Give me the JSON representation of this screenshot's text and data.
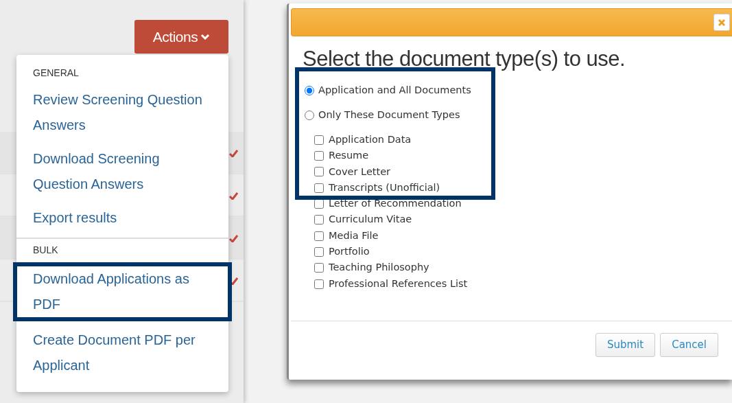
{
  "actions_button": {
    "label": "Actions"
  },
  "menu": {
    "sections": [
      {
        "heading": "GENERAL",
        "items": [
          {
            "label": "Review Screening Question Answers",
            "highlighted": false
          },
          {
            "label": "Download Screening Question Answers",
            "highlighted": false
          },
          {
            "label": "Export results",
            "highlighted": false
          }
        ]
      },
      {
        "heading": "BULK",
        "items": [
          {
            "label": "Download Applications as PDF",
            "highlighted": true
          },
          {
            "label": "Create Document PDF per Applicant",
            "highlighted": false
          }
        ]
      }
    ]
  },
  "dialog": {
    "title": "Select the document type(s) to use.",
    "options_highlighted": true,
    "options": [
      {
        "label": "Application and All Documents",
        "selected": true
      },
      {
        "label": "Only These Document Types",
        "selected": false
      }
    ],
    "document_types": [
      {
        "label": "Application Data",
        "checked": false
      },
      {
        "label": "Resume",
        "checked": false
      },
      {
        "label": "Cover Letter",
        "checked": false
      },
      {
        "label": "Transcripts (Unofficial)",
        "checked": false
      },
      {
        "label": "Letter of Recommendation",
        "checked": false
      },
      {
        "label": "Curriculum Vitae",
        "checked": false
      },
      {
        "label": "Media File",
        "checked": false
      },
      {
        "label": "Portfolio",
        "checked": false
      },
      {
        "label": "Teaching Philosophy",
        "checked": false
      },
      {
        "label": "Professional References List",
        "checked": false
      }
    ],
    "buttons": [
      "Submit",
      "Cancel"
    ]
  }
}
